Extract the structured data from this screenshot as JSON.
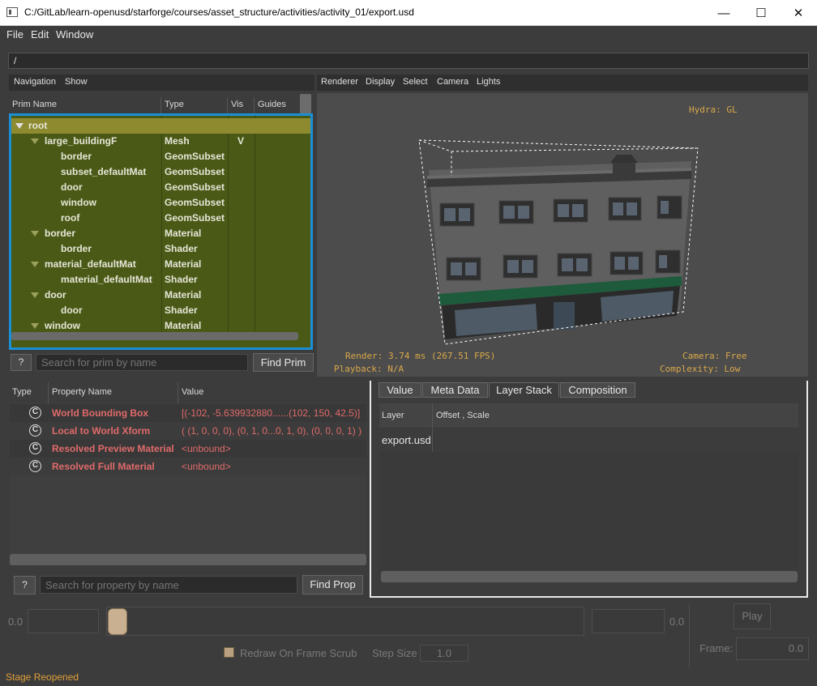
{
  "window": {
    "title": "C:/GitLab/learn-openusd/starforge/courses/asset_structure/activities/activity_01/export.usd",
    "minimize": "—",
    "maximize": "☐",
    "close": "✕"
  },
  "menu": [
    "File",
    "Edit",
    "Window"
  ],
  "path": "/",
  "navigation": {
    "menu": [
      "Navigation",
      "Show"
    ],
    "columns": [
      "Prim Name",
      "Type",
      "Vis",
      "Guides"
    ],
    "rows": [
      {
        "name": "root",
        "type": "",
        "vis": "",
        "expanded": true
      },
      {
        "name": "large_buildingF",
        "type": "Mesh",
        "vis": "V",
        "expanded": true
      },
      {
        "name": "border",
        "type": "GeomSubset",
        "vis": ""
      },
      {
        "name": "subset_defaultMat",
        "type": "GeomSubset",
        "vis": ""
      },
      {
        "name": "door",
        "type": "GeomSubset",
        "vis": ""
      },
      {
        "name": "window",
        "type": "GeomSubset",
        "vis": ""
      },
      {
        "name": "roof",
        "type": "GeomSubset",
        "vis": ""
      },
      {
        "name": "border",
        "type": "Material",
        "vis": "",
        "expanded": true
      },
      {
        "name": "border",
        "type": "Shader",
        "vis": ""
      },
      {
        "name": "material_defaultMat",
        "type": "Material",
        "vis": "",
        "expanded": true
      },
      {
        "name": "material_defaultMat",
        "type": "Shader",
        "vis": ""
      },
      {
        "name": "door",
        "type": "Material",
        "vis": "",
        "expanded": true
      },
      {
        "name": "door",
        "type": "Shader",
        "vis": ""
      },
      {
        "name": "window",
        "type": "Material",
        "vis": "",
        "expanded": true
      }
    ],
    "help_label": "?",
    "search_placeholder": "Search for prim by name",
    "find_label": "Find Prim"
  },
  "viewport": {
    "menu": [
      "Renderer",
      "Display",
      "Select",
      "Camera",
      "Lights"
    ],
    "renderer": "Hydra: GL",
    "render_stats": "Render: 3.74 ms (267.51 FPS)",
    "playback": "Playback: N/A",
    "camera": "Camera: Free",
    "complexity": "Complexity: Low"
  },
  "properties": {
    "columns": [
      "Type",
      "Property Name",
      "Value"
    ],
    "rows": [
      {
        "icon": "C",
        "name": "World Bounding Box",
        "value": "[(-102, -5.639932880......(102, 150, 42.5)]"
      },
      {
        "icon": "C",
        "name": "Local to World Xform",
        "value": "( (1, 0, 0, 0), (0, 1, 0...0, 1, 0), (0, 0, 0, 1) )"
      },
      {
        "icon": "C",
        "name": "Resolved Preview Material",
        "value": "<unbound>"
      },
      {
        "icon": "C",
        "name": "Resolved Full Material",
        "value": "<unbound>"
      }
    ],
    "help_label": "?",
    "search_placeholder": "Search for property by name",
    "find_label": "Find Prop"
  },
  "inspector": {
    "tabs": [
      "Value",
      "Meta Data",
      "Layer Stack",
      "Composition"
    ],
    "active_tab": "Layer Stack",
    "columns": [
      "Layer",
      "Offset , Scale"
    ],
    "rows": [
      {
        "layer": "export.usd",
        "offset": ""
      }
    ]
  },
  "timeline": {
    "start": "0.0",
    "end": "0.0",
    "play": "Play",
    "redraw_label": "Redraw On Frame Scrub",
    "step_label": "Step Size",
    "step_value": "1.0",
    "frame_label": "Frame:",
    "frame_value": "0.0"
  },
  "status": "Stage Reopened",
  "colors": {
    "selection_border": "#1a8fd6",
    "tree_bg": "#4a5a16",
    "selected_row": "#8e8a30",
    "property_text": "#e06a6a",
    "hud_text": "#d8a74a",
    "status_text": "#e0a03a"
  }
}
